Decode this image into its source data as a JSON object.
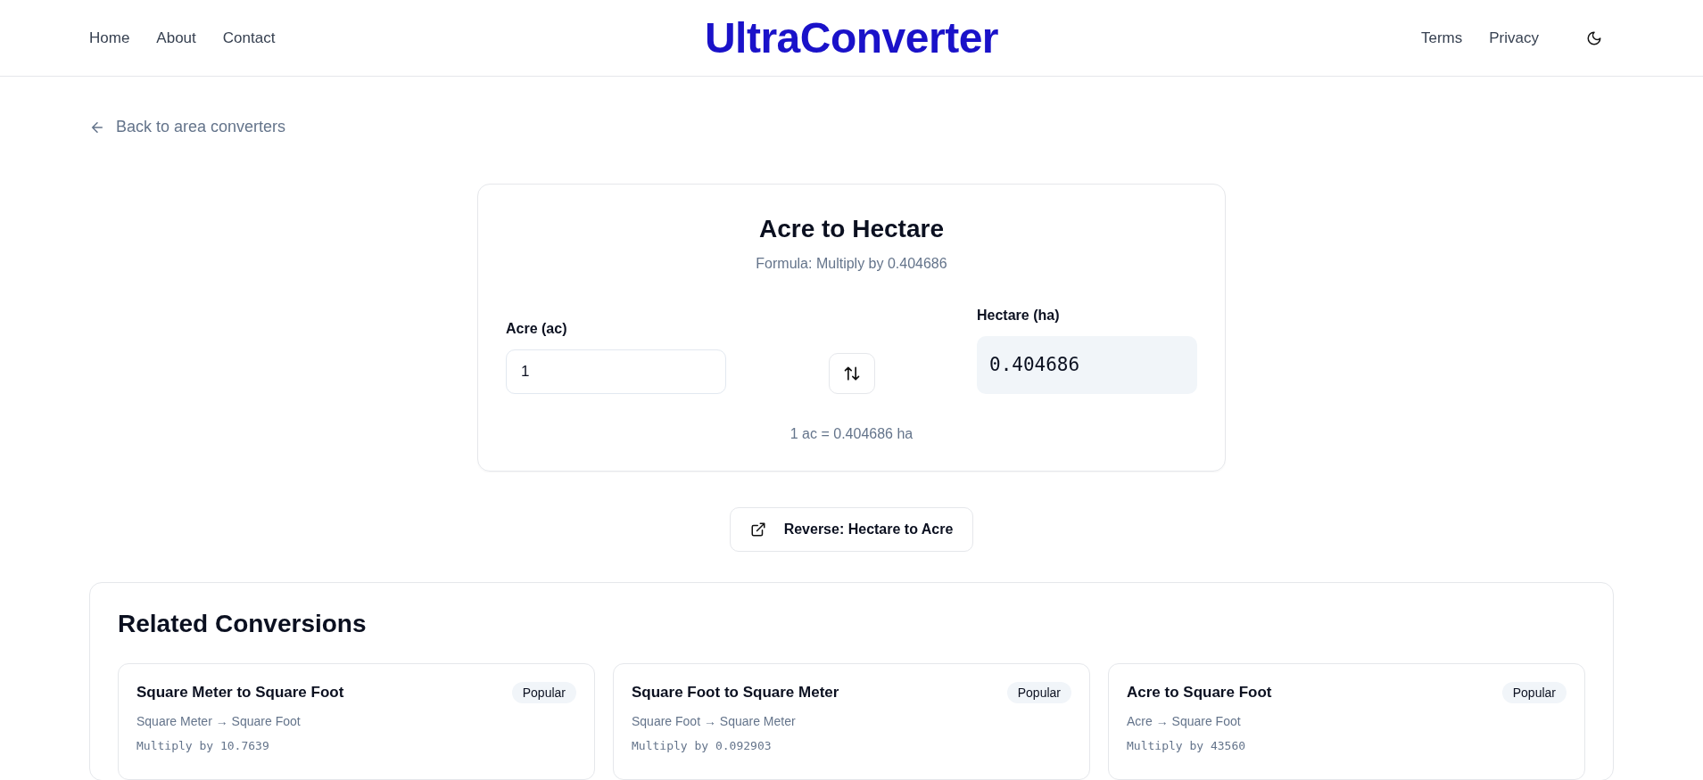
{
  "header": {
    "nav_left": [
      "Home",
      "About",
      "Contact"
    ],
    "logo": "UltraConverter",
    "nav_right": [
      "Terms",
      "Privacy"
    ]
  },
  "back_link": "Back to area converters",
  "converter": {
    "title": "Acre to Hectare",
    "formula": "Formula: Multiply by 0.404686",
    "from": {
      "label": "Acre (ac)",
      "value": "1"
    },
    "to": {
      "label": "Hectare (ha)",
      "value": "0.404686"
    },
    "equation": "1 ac = 0.404686 ha"
  },
  "reverse_button": "Reverse: Hectare to Acre",
  "related": {
    "title": "Related Conversions",
    "items": [
      {
        "title": "Square Meter to Square Foot",
        "badge": "Popular",
        "units": "Square Meter → Square Foot",
        "formula": "Multiply by 10.7639"
      },
      {
        "title": "Square Foot to Square Meter",
        "badge": "Popular",
        "units": "Square Foot → Square Meter",
        "formula": "Multiply by 0.092903"
      },
      {
        "title": "Acre to Square Foot",
        "badge": "Popular",
        "units": "Acre → Square Foot",
        "formula": "Multiply by 43560"
      }
    ]
  }
}
